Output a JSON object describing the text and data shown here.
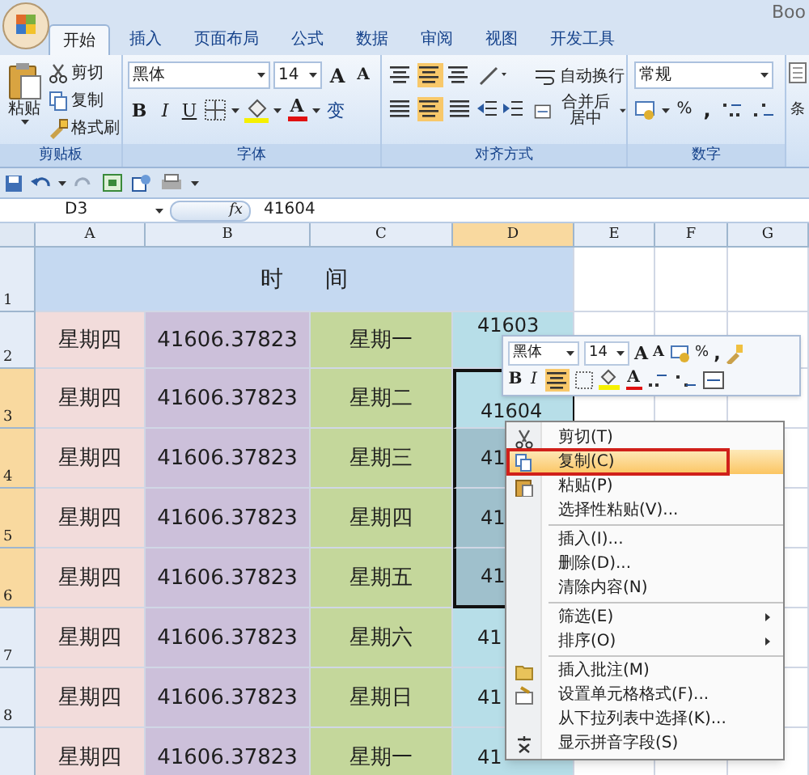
{
  "window": {
    "title": "Boo"
  },
  "tabs": [
    {
      "label": "开始",
      "selected": true
    },
    {
      "label": "插入",
      "selected": false
    },
    {
      "label": "页面布局",
      "selected": false
    },
    {
      "label": "公式",
      "selected": false
    },
    {
      "label": "数据",
      "selected": false
    },
    {
      "label": "审阅",
      "selected": false
    },
    {
      "label": "视图",
      "selected": false
    },
    {
      "label": "开发工具",
      "selected": false
    }
  ],
  "ribbon": {
    "clipboard": {
      "paste": "粘贴",
      "cut": "剪切",
      "copy": "复制",
      "format_painter": "格式刷",
      "label": "剪贴板"
    },
    "font": {
      "name": "黑体",
      "size": "14",
      "grow": "A",
      "shrink": "A",
      "bold": "B",
      "italic": "I",
      "underline": "U",
      "font_color": "A",
      "phonetic": "变",
      "label": "字体"
    },
    "alignment": {
      "wrap": "自动换行",
      "merge": "合并后居中",
      "label": "对齐方式"
    },
    "number": {
      "format": "常规",
      "percent": "%",
      "comma": ",",
      "label": "数字"
    },
    "styles": {
      "conditional": "条"
    }
  },
  "formula_bar": {
    "name_box": "D3",
    "fx": "fx",
    "value": "41604"
  },
  "columns": [
    {
      "label": "A",
      "selected": false
    },
    {
      "label": "B",
      "selected": false
    },
    {
      "label": "C",
      "selected": false
    },
    {
      "label": "D",
      "selected": true
    },
    {
      "label": "E",
      "selected": false
    },
    {
      "label": "F",
      "selected": false
    },
    {
      "label": "G",
      "selected": false
    }
  ],
  "title_row": {
    "number": "1",
    "text": "时 间"
  },
  "rows": [
    {
      "number": "2",
      "selected": false,
      "cells": [
        "星期四",
        "41606.37823",
        "星期一",
        "41603"
      ]
    },
    {
      "number": "3",
      "selected": true,
      "cells": [
        "星期四",
        "41606.37823",
        "星期二",
        "41604"
      ]
    },
    {
      "number": "4",
      "selected": true,
      "cells": [
        "星期四",
        "41606.37823",
        "星期三",
        "41"
      ]
    },
    {
      "number": "5",
      "selected": true,
      "cells": [
        "星期四",
        "41606.37823",
        "星期四",
        "41"
      ]
    },
    {
      "number": "6",
      "selected": true,
      "cells": [
        "星期四",
        "41606.37823",
        "星期五",
        "41"
      ]
    },
    {
      "number": "7",
      "selected": false,
      "cells": [
        "星期四",
        "41606.37823",
        "星期六",
        "41"
      ]
    },
    {
      "number": "8",
      "selected": false,
      "cells": [
        "星期四",
        "41606.37823",
        "星期日",
        "41"
      ]
    },
    {
      "selected": false,
      "cells": [
        "星期四",
        "41606.37823",
        "星期一",
        "41"
      ]
    }
  ],
  "mini_toolbar": {
    "font": "黑体",
    "size": "14",
    "grow": "A",
    "shrink": "A",
    "percent": "%",
    "comma": ",",
    "bold": "B",
    "italic": "I",
    "center_selected": true,
    "font_color": "A"
  },
  "context_menu": [
    {
      "kind": "item",
      "label": "剪切(T)",
      "selected": false
    },
    {
      "kind": "item",
      "label": "复制(C)",
      "selected": true
    },
    {
      "kind": "item",
      "label": "粘贴(P)",
      "selected": false
    },
    {
      "kind": "item",
      "label": "选择性粘贴(V)...",
      "selected": false
    },
    {
      "kind": "separator"
    },
    {
      "kind": "item",
      "label": "插入(I)...",
      "selected": false
    },
    {
      "kind": "item",
      "label": "删除(D)...",
      "selected": false
    },
    {
      "kind": "item",
      "label": "清除内容(N)",
      "selected": false
    },
    {
      "kind": "separator"
    },
    {
      "kind": "submenu",
      "label": "筛选(E)",
      "selected": false
    },
    {
      "kind": "submenu",
      "label": "排序(O)",
      "selected": false
    },
    {
      "kind": "separator"
    },
    {
      "kind": "item",
      "label": "插入批注(M)",
      "selected": false
    },
    {
      "kind": "item",
      "label": "设置单元格格式(F)...",
      "selected": false
    },
    {
      "kind": "item",
      "label": "从下拉列表中选择(K)...",
      "selected": false
    },
    {
      "kind": "item",
      "label": "显示拼音字段(S)",
      "selected": false
    }
  ],
  "annotation": {
    "kind": "frame"
  }
}
